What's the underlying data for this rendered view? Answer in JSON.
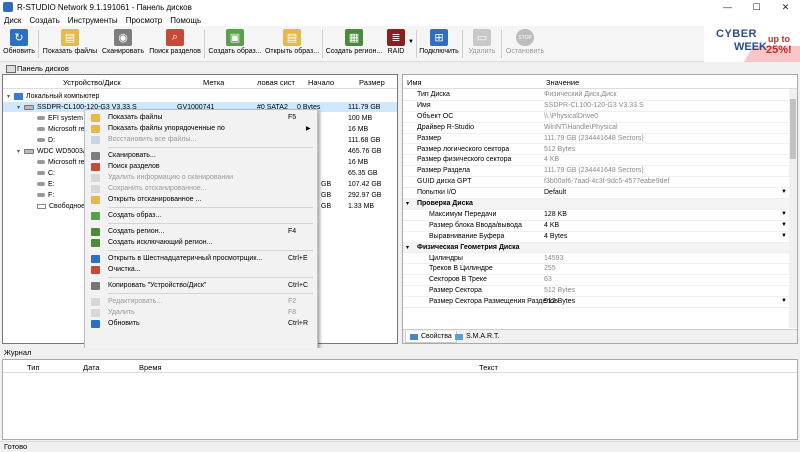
{
  "window": {
    "title": "R-STUDIO Network 9.1.191061 - Панель дисков",
    "controls": [
      "—",
      "☐",
      "✕"
    ]
  },
  "menu": [
    "Диск",
    "Создать",
    "Инструменты",
    "Просмотр",
    "Помощь"
  ],
  "toolbar": {
    "refresh": "Обновить",
    "show_files": "Показать файлы",
    "scan": "Сканировать",
    "find_partitions": "Поиск разделов",
    "create_image": "Создать образ...",
    "open_image": "Открыть образ...",
    "create_region": "Создать регион...",
    "raid": "RAID",
    "connect": "Подключить",
    "delete": "Удалить",
    "stop": "Остановить"
  },
  "banner": {
    "line1": "CYBER",
    "line2": "WEEK",
    "up_to": "up to",
    "percent": "25%!"
  },
  "panel_tab": "Панель дисков",
  "drive_columns": [
    "Устройство/Диск",
    "Метка",
    "ловая сист",
    "Начало",
    "Размер"
  ],
  "drive_tree": [
    {
      "name": "Локальный компьютер",
      "label": "",
      "fs": "",
      "start": "",
      "size": ""
    },
    {
      "name": "SSDPR-CL100-120-G3 V3.33.S",
      "label": "GV1000741",
      "fs": "#0 SATA2",
      "start": "0 Bytes",
      "size": "111.79 GB"
    },
    {
      "name": "EFI system p",
      "label": "",
      "fs": "",
      "start": "",
      "size": "100 MB"
    },
    {
      "name": "Microsoft re",
      "label": "",
      "fs": "",
      "start": "",
      "size": "16 MB"
    },
    {
      "name": "D:",
      "label": "",
      "fs": "",
      "start": "",
      "size": "111.68 GB"
    },
    {
      "name": "WDC WD5003A",
      "label": "",
      "fs": "",
      "start": "",
      "size": "465.76 GB"
    },
    {
      "name": "Microsoft re",
      "label": "",
      "fs": "",
      "start": "",
      "size": "16 MB"
    },
    {
      "name": "C:",
      "label": "",
      "fs": "",
      "start": "",
      "size": "65.35 GB"
    },
    {
      "name": "E:",
      "label": "",
      "fs": "GB",
      "start": "",
      "size": "107.42 GB"
    },
    {
      "name": "F:",
      "label": "",
      "fs": "GB",
      "start": "",
      "size": "292.97 GB"
    },
    {
      "name": "Свободное",
      "label": "",
      "fs": "GB",
      "start": "",
      "size": "1.33 MB"
    }
  ],
  "context_menu": [
    {
      "label": "Показать файлы",
      "shortcut": "F5",
      "disabled": false,
      "sep_after": false,
      "submenu": false
    },
    {
      "label": "Показать файлы упорядоченные по",
      "shortcut": "",
      "disabled": false,
      "sep_after": false,
      "submenu": true
    },
    {
      "label": "Восстановить все файлы...",
      "shortcut": "",
      "disabled": true,
      "sep_after": true,
      "submenu": false
    },
    {
      "label": "Сканировать...",
      "shortcut": "",
      "disabled": false,
      "sep_after": false,
      "submenu": false
    },
    {
      "label": "Поиск разделов",
      "shortcut": "",
      "disabled": false,
      "sep_after": false,
      "submenu": false
    },
    {
      "label": "Удалить информацию о сканировании",
      "shortcut": "",
      "disabled": true,
      "sep_after": false,
      "submenu": false
    },
    {
      "label": "Сохранить отсканированное...",
      "shortcut": "",
      "disabled": true,
      "sep_after": false,
      "submenu": false
    },
    {
      "label": "Открыть отсканированное ...",
      "shortcut": "",
      "disabled": false,
      "sep_after": true,
      "submenu": false
    },
    {
      "label": "Создать образ...",
      "shortcut": "",
      "disabled": false,
      "sep_after": true,
      "submenu": false
    },
    {
      "label": "Создать регион...",
      "shortcut": "F4",
      "disabled": false,
      "sep_after": false,
      "submenu": false
    },
    {
      "label": "Создать исключающий регион...",
      "shortcut": "",
      "disabled": false,
      "sep_after": true,
      "submenu": false
    },
    {
      "label": "Открыть в Шестнадцатеричный просмотрщик...",
      "shortcut": "Ctrl+E",
      "disabled": false,
      "sep_after": false,
      "submenu": false
    },
    {
      "label": "Очистка...",
      "shortcut": "",
      "disabled": false,
      "sep_after": true,
      "submenu": false
    },
    {
      "label": "Копировать \"Устройство/Диск\"",
      "shortcut": "Ctrl+C",
      "disabled": false,
      "sep_after": true,
      "submenu": false
    },
    {
      "label": "Редактировать...",
      "shortcut": "F2",
      "disabled": true,
      "sep_after": false,
      "submenu": false
    },
    {
      "label": "Удалить",
      "shortcut": "F8",
      "disabled": true,
      "sep_after": false,
      "submenu": false
    },
    {
      "label": "Обновить",
      "shortcut": "Ctrl+R",
      "disabled": false,
      "sep_after": false,
      "submenu": false
    }
  ],
  "prop_columns": [
    "Имя",
    "Значение"
  ],
  "properties": [
    {
      "name": "Тип Диска",
      "value": "Физический Диск,Диск",
      "group": false,
      "editable": false
    },
    {
      "name": "Имя",
      "value": "SSDPR-CL100-120-G3 V3.33.S",
      "group": false,
      "editable": false
    },
    {
      "name": "Объект ОС",
      "value": "\\\\.\\PhysicalDrive0",
      "group": false,
      "editable": false
    },
    {
      "name": "Драйвер R-Studio",
      "value": "WinNT\\Handle\\Physical",
      "group": false,
      "editable": false
    },
    {
      "name": "Размер",
      "value": "111.79 GB (234441648 Sectors)",
      "group": false,
      "editable": false
    },
    {
      "name": "Размер логического сектора",
      "value": "512 Bytes",
      "group": false,
      "editable": false
    },
    {
      "name": "Размер физического сектора",
      "value": "4 KB",
      "group": false,
      "editable": false
    },
    {
      "name": "Размер Раздела",
      "value": "111.79 GB (234441648 Sectors)",
      "group": false,
      "editable": false
    },
    {
      "name": "GUID диска GPT",
      "value": "f3b00af6-7aad-4c3f-9dc5-4577eabe9def",
      "group": false,
      "editable": false
    },
    {
      "name": "Попытки I/O",
      "value": "Default",
      "group": false,
      "editable": true
    },
    {
      "name": "Проверка Диска",
      "value": "",
      "group": true,
      "editable": false
    },
    {
      "name": "Максимум Передачи",
      "value": "128 KB",
      "group": false,
      "editable": true
    },
    {
      "name": "Размер блока Ввода/вывода",
      "value": "4 KB",
      "group": false,
      "editable": true
    },
    {
      "name": "Выравнивание Буфера",
      "value": "4 Bytes",
      "group": false,
      "editable": true
    },
    {
      "name": "Физическая Геометрия Диска",
      "value": "",
      "group": true,
      "editable": false
    },
    {
      "name": "Цилиндры",
      "value": "14593",
      "group": false,
      "editable": false
    },
    {
      "name": "Треков В Цилиндре",
      "value": "255",
      "group": false,
      "editable": false
    },
    {
      "name": "Секторов В Треке",
      "value": "63",
      "group": false,
      "editable": false
    },
    {
      "name": "Размер Сектора",
      "value": "512 Bytes",
      "group": false,
      "editable": false
    },
    {
      "name": "Размер Сектора Размещения Разделов",
      "value": "512 Bytes",
      "group": false,
      "editable": true
    }
  ],
  "prop_tabs": [
    "Свойства",
    "S.M.A.R.T."
  ],
  "log": {
    "title": "Журнал",
    "columns": [
      "Тип",
      "Дата",
      "Время",
      "Текст"
    ]
  },
  "status": "Готово"
}
